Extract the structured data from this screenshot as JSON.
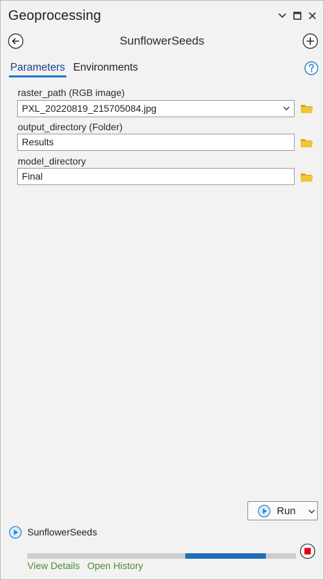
{
  "window": {
    "title": "Geoprocessing"
  },
  "tool": {
    "name": "SunflowerSeeds"
  },
  "tabs": [
    {
      "label": "Parameters",
      "active": true
    },
    {
      "label": "Environments",
      "active": false
    }
  ],
  "parameters": [
    {
      "label": "raster_path (RGB image)",
      "value": "PXL_20220819_215705084.jpg",
      "dropdown": true
    },
    {
      "label": "output_directory (Folder)",
      "value": "Results",
      "dropdown": false
    },
    {
      "label": "model_directory",
      "value": "Final",
      "dropdown": false
    }
  ],
  "run_button": {
    "label": "Run"
  },
  "status": {
    "tool_name": "SunflowerSeeds",
    "links": {
      "view_details": "View Details",
      "open_history": "Open History"
    }
  },
  "colors": {
    "accent": "#1f78c8",
    "folder": "#e8b822",
    "link": "#4a8a2e",
    "stop": "#e3000f",
    "progress": "#1e6fba"
  },
  "icons": [
    "back-icon",
    "add-icon",
    "help-icon",
    "folder-icon",
    "play-icon",
    "stop-icon",
    "chevron-down-icon"
  ]
}
